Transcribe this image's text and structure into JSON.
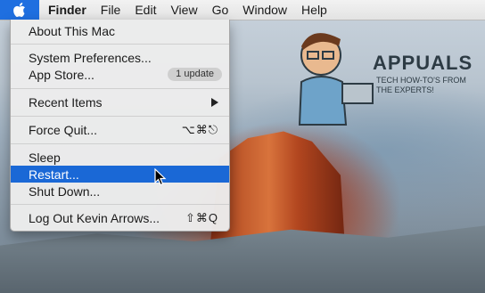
{
  "menubar": {
    "app_name": "Finder",
    "items": [
      "File",
      "Edit",
      "View",
      "Go",
      "Window",
      "Help"
    ]
  },
  "apple_menu": {
    "about": "About This Mac",
    "system_preferences": "System Preferences...",
    "app_store": "App Store...",
    "app_store_badge": "1 update",
    "recent_items": "Recent Items",
    "force_quit": "Force Quit...",
    "force_quit_shortcut": "⌥⌘⎋",
    "sleep": "Sleep",
    "restart": "Restart...",
    "shut_down": "Shut Down...",
    "log_out": "Log Out Kevin Arrows...",
    "log_out_shortcut": "⇧⌘Q"
  },
  "watermark": {
    "brand": "APPUALS",
    "tagline": "TECH HOW-TO'S FROM THE EXPERTS!"
  },
  "colors": {
    "highlight": "#1a68d6",
    "apple_menu_active": "#1f6fe0"
  }
}
